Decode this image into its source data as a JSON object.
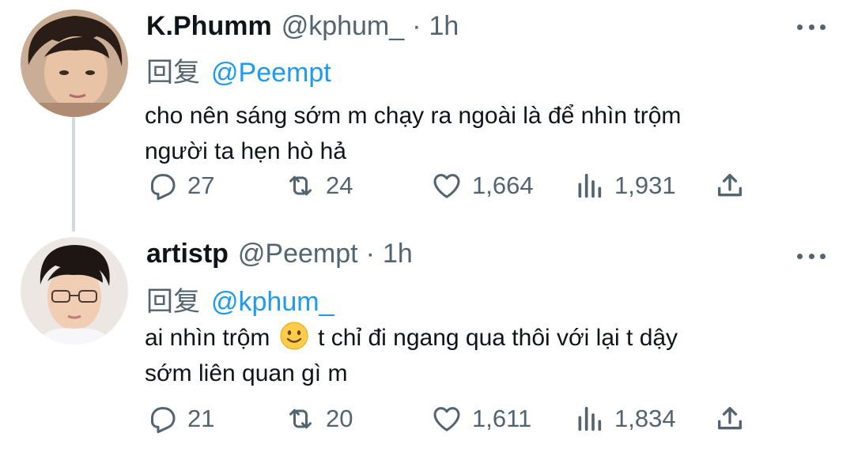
{
  "reply_prefix": "回复",
  "tweets": [
    {
      "name": "K.Phumm",
      "handle": "@kphum_",
      "time": "1h",
      "reply_to": "@Peempt",
      "text_line1": "cho nên sáng sớm m chạy ra ngoài là để nhìn trộm",
      "text_line2": "người ta hẹn hò hả",
      "replies": "27",
      "retweets": "24",
      "likes": "1,664",
      "views": "1,931"
    },
    {
      "name": "artistp",
      "handle": "@Peempt",
      "time": "1h",
      "reply_to": "@kphum_",
      "text_before_emoji": "ai nhìn trộm",
      "emoji": "slightly-smiling-face",
      "text_after_emoji": "t chỉ đi ngang qua thôi với lại t dậy",
      "text_line2": "sớm liên quan gì m",
      "replies": "21",
      "retweets": "20",
      "likes": "1,611",
      "views": "1,834"
    }
  ],
  "icons": {
    "reply": "reply-icon",
    "retweet": "retweet-icon",
    "like": "heart-icon",
    "views": "views-icon",
    "share": "share-icon",
    "more": "more-icon"
  },
  "colors": {
    "text": "#0f1419",
    "secondary": "#536471",
    "link": "#1d9bf0",
    "thread_line": "#cfd9de"
  }
}
